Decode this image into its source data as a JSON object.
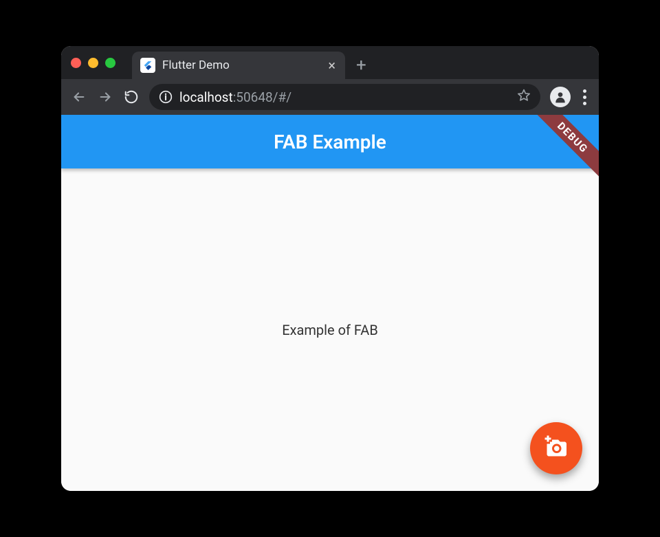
{
  "browser": {
    "tab_title": "Flutter Demo",
    "url_host": "localhost",
    "url_rest": ":50648/#/"
  },
  "app": {
    "appbar_title": "FAB Example",
    "body_text": "Example of FAB",
    "debug_label": "DEBUG"
  },
  "icons": {
    "fab": "add-a-photo"
  }
}
